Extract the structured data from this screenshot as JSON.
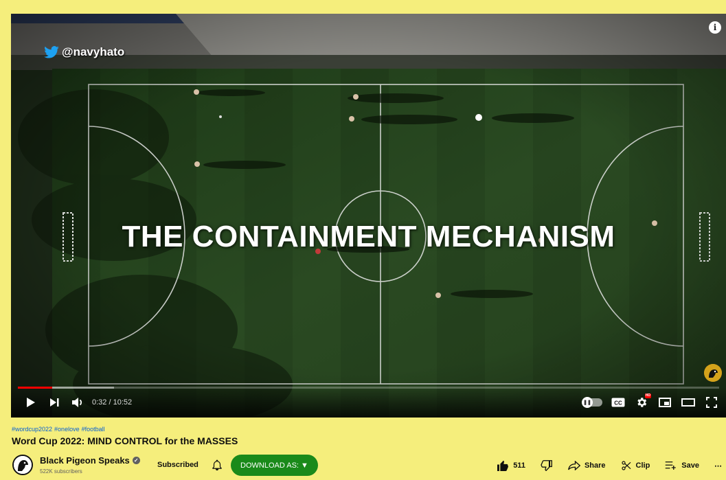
{
  "player": {
    "watermark": "@navyhato",
    "overlay_title": "THE CONTAINMENT MECHANISM",
    "info_glyph": "i",
    "time_display": "0:32 / 10:52",
    "progress_fraction": 0.049,
    "buffered_fraction": 0.137,
    "progress_color": "#ff0000",
    "controls": {
      "left": [
        "play-icon",
        "next-icon",
        "volume-icon"
      ],
      "right": [
        "autoplay-toggle",
        "captions-icon",
        "settings-icon",
        "miniplayer-icon",
        "theater-icon",
        "fullscreen-icon"
      ]
    },
    "captions_label": "CC",
    "hd_label": "HD"
  },
  "video": {
    "hashtags": [
      "#wordcup2022",
      "#onelove",
      "#football"
    ],
    "title": "Word Cup 2022: MIND CONTROL for the MASSES"
  },
  "channel": {
    "name": "Black Pigeon Speaks",
    "subscribers": "522K subscribers",
    "subscribed_label": "Subscribed",
    "download_label": "DOWNLOAD AS: ▼",
    "download_color": "#1a8a1a"
  },
  "actions": {
    "likes": "511",
    "share": "Share",
    "clip": "Clip",
    "save": "Save",
    "more": "⋯"
  },
  "colors": {
    "page_background": "#f5ee7c",
    "link": "#065fd4"
  }
}
